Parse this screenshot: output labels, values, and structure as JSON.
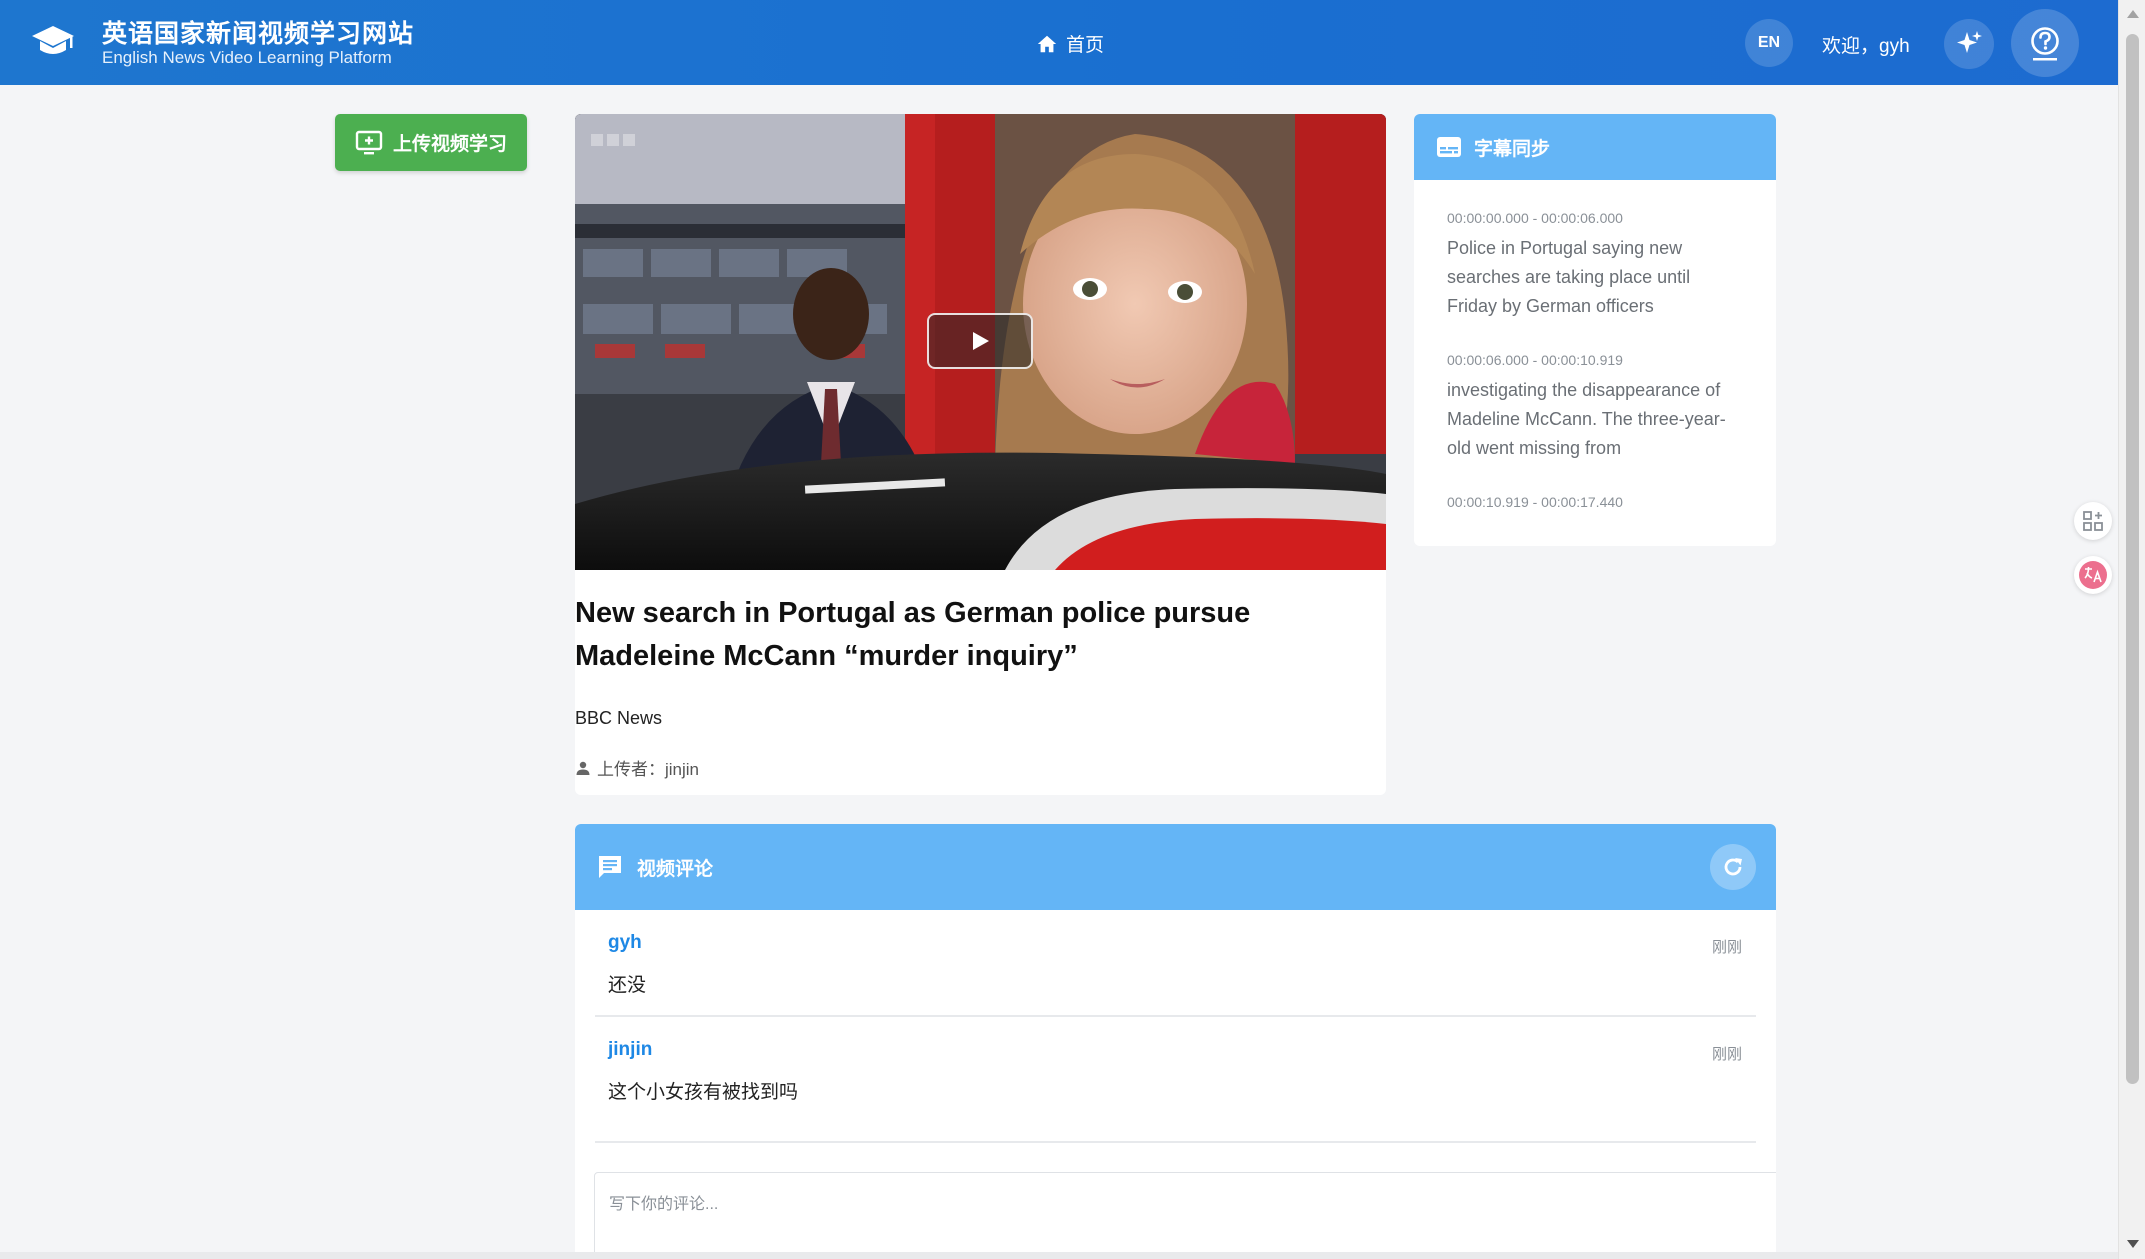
{
  "header": {
    "title": "英语国家新闻视频学习网站",
    "subtitle": "English News Video Learning Platform",
    "nav_home": "首页",
    "lang": "EN",
    "welcome": "欢迎，gyh",
    "icons": {
      "logo": "graduation-cap-icon",
      "home": "home-icon",
      "sparkle": "sparkle-icon",
      "help": "help-circle-icon"
    }
  },
  "upload": {
    "label": "上传视频学习",
    "icon": "monitor-add-icon"
  },
  "video": {
    "title": "New search in Portugal as German police pursue Madeleine McCann “murder inquiry”",
    "source": "BBC News",
    "uploader": "上传者：jinjin"
  },
  "subtitles": {
    "title": "字幕同步",
    "items": [
      {
        "time": "00:00:00.000 - 00:00:06.000",
        "text": "Police in Portugal saying new searches are taking place until Friday by German officers"
      },
      {
        "time": "00:00:06.000 - 00:00:10.919",
        "text": "investigating the disappearance of Madeline McCann. The three-year-old went missing from"
      },
      {
        "time": "00:00:10.919 - 00:00:17.440",
        "text": ""
      }
    ]
  },
  "comments": {
    "title": "视频评论",
    "items": [
      {
        "user": "gyh",
        "time": "刚刚",
        "text": "还没"
      },
      {
        "user": "jinjin",
        "time": "刚刚",
        "text": "这个小女孩有被找到吗"
      }
    ],
    "placeholder": "写下你的评论..."
  },
  "colors": {
    "header_blue": "#1e76cf",
    "panel_blue": "#64b5f6",
    "upload_green": "#4caf50",
    "link_blue": "#1e88e5"
  }
}
